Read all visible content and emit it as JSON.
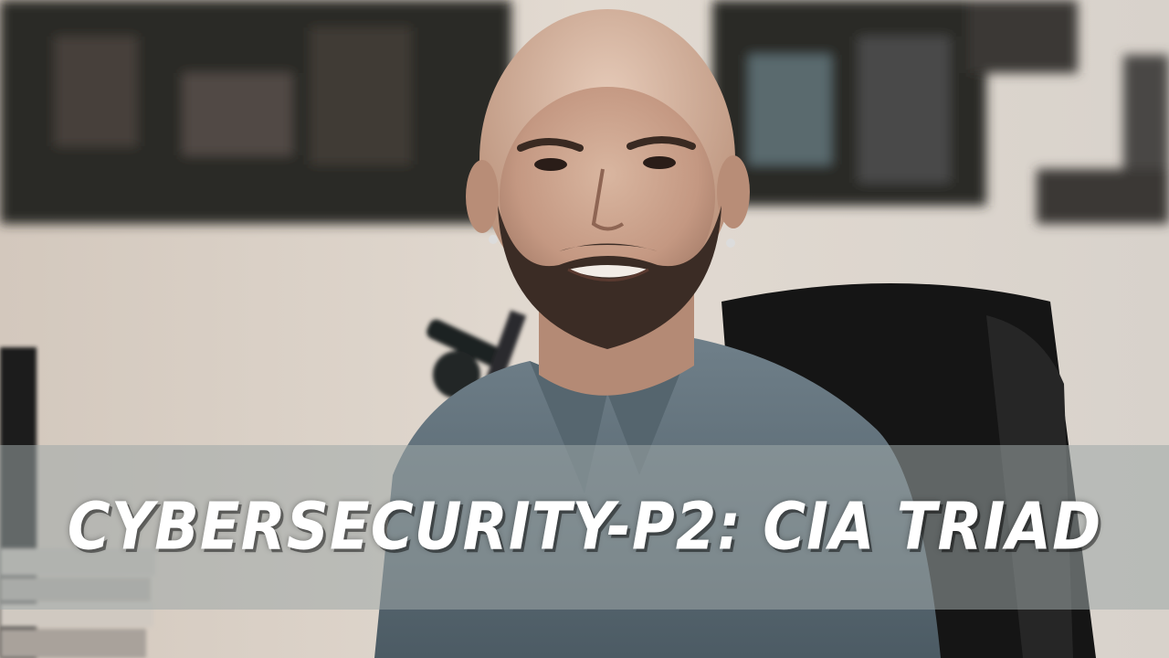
{
  "thumbnail": {
    "title": "CYBERSECURITY-P2: CIA TRIAD",
    "banner_color": "#9ea8a8",
    "text_color": "#ffffff"
  },
  "scene": {
    "subject": "person-portrait",
    "shirt_color": "#5e6e78",
    "wall_color": "#d9d1c9",
    "shelf_color": "#2a2826"
  }
}
